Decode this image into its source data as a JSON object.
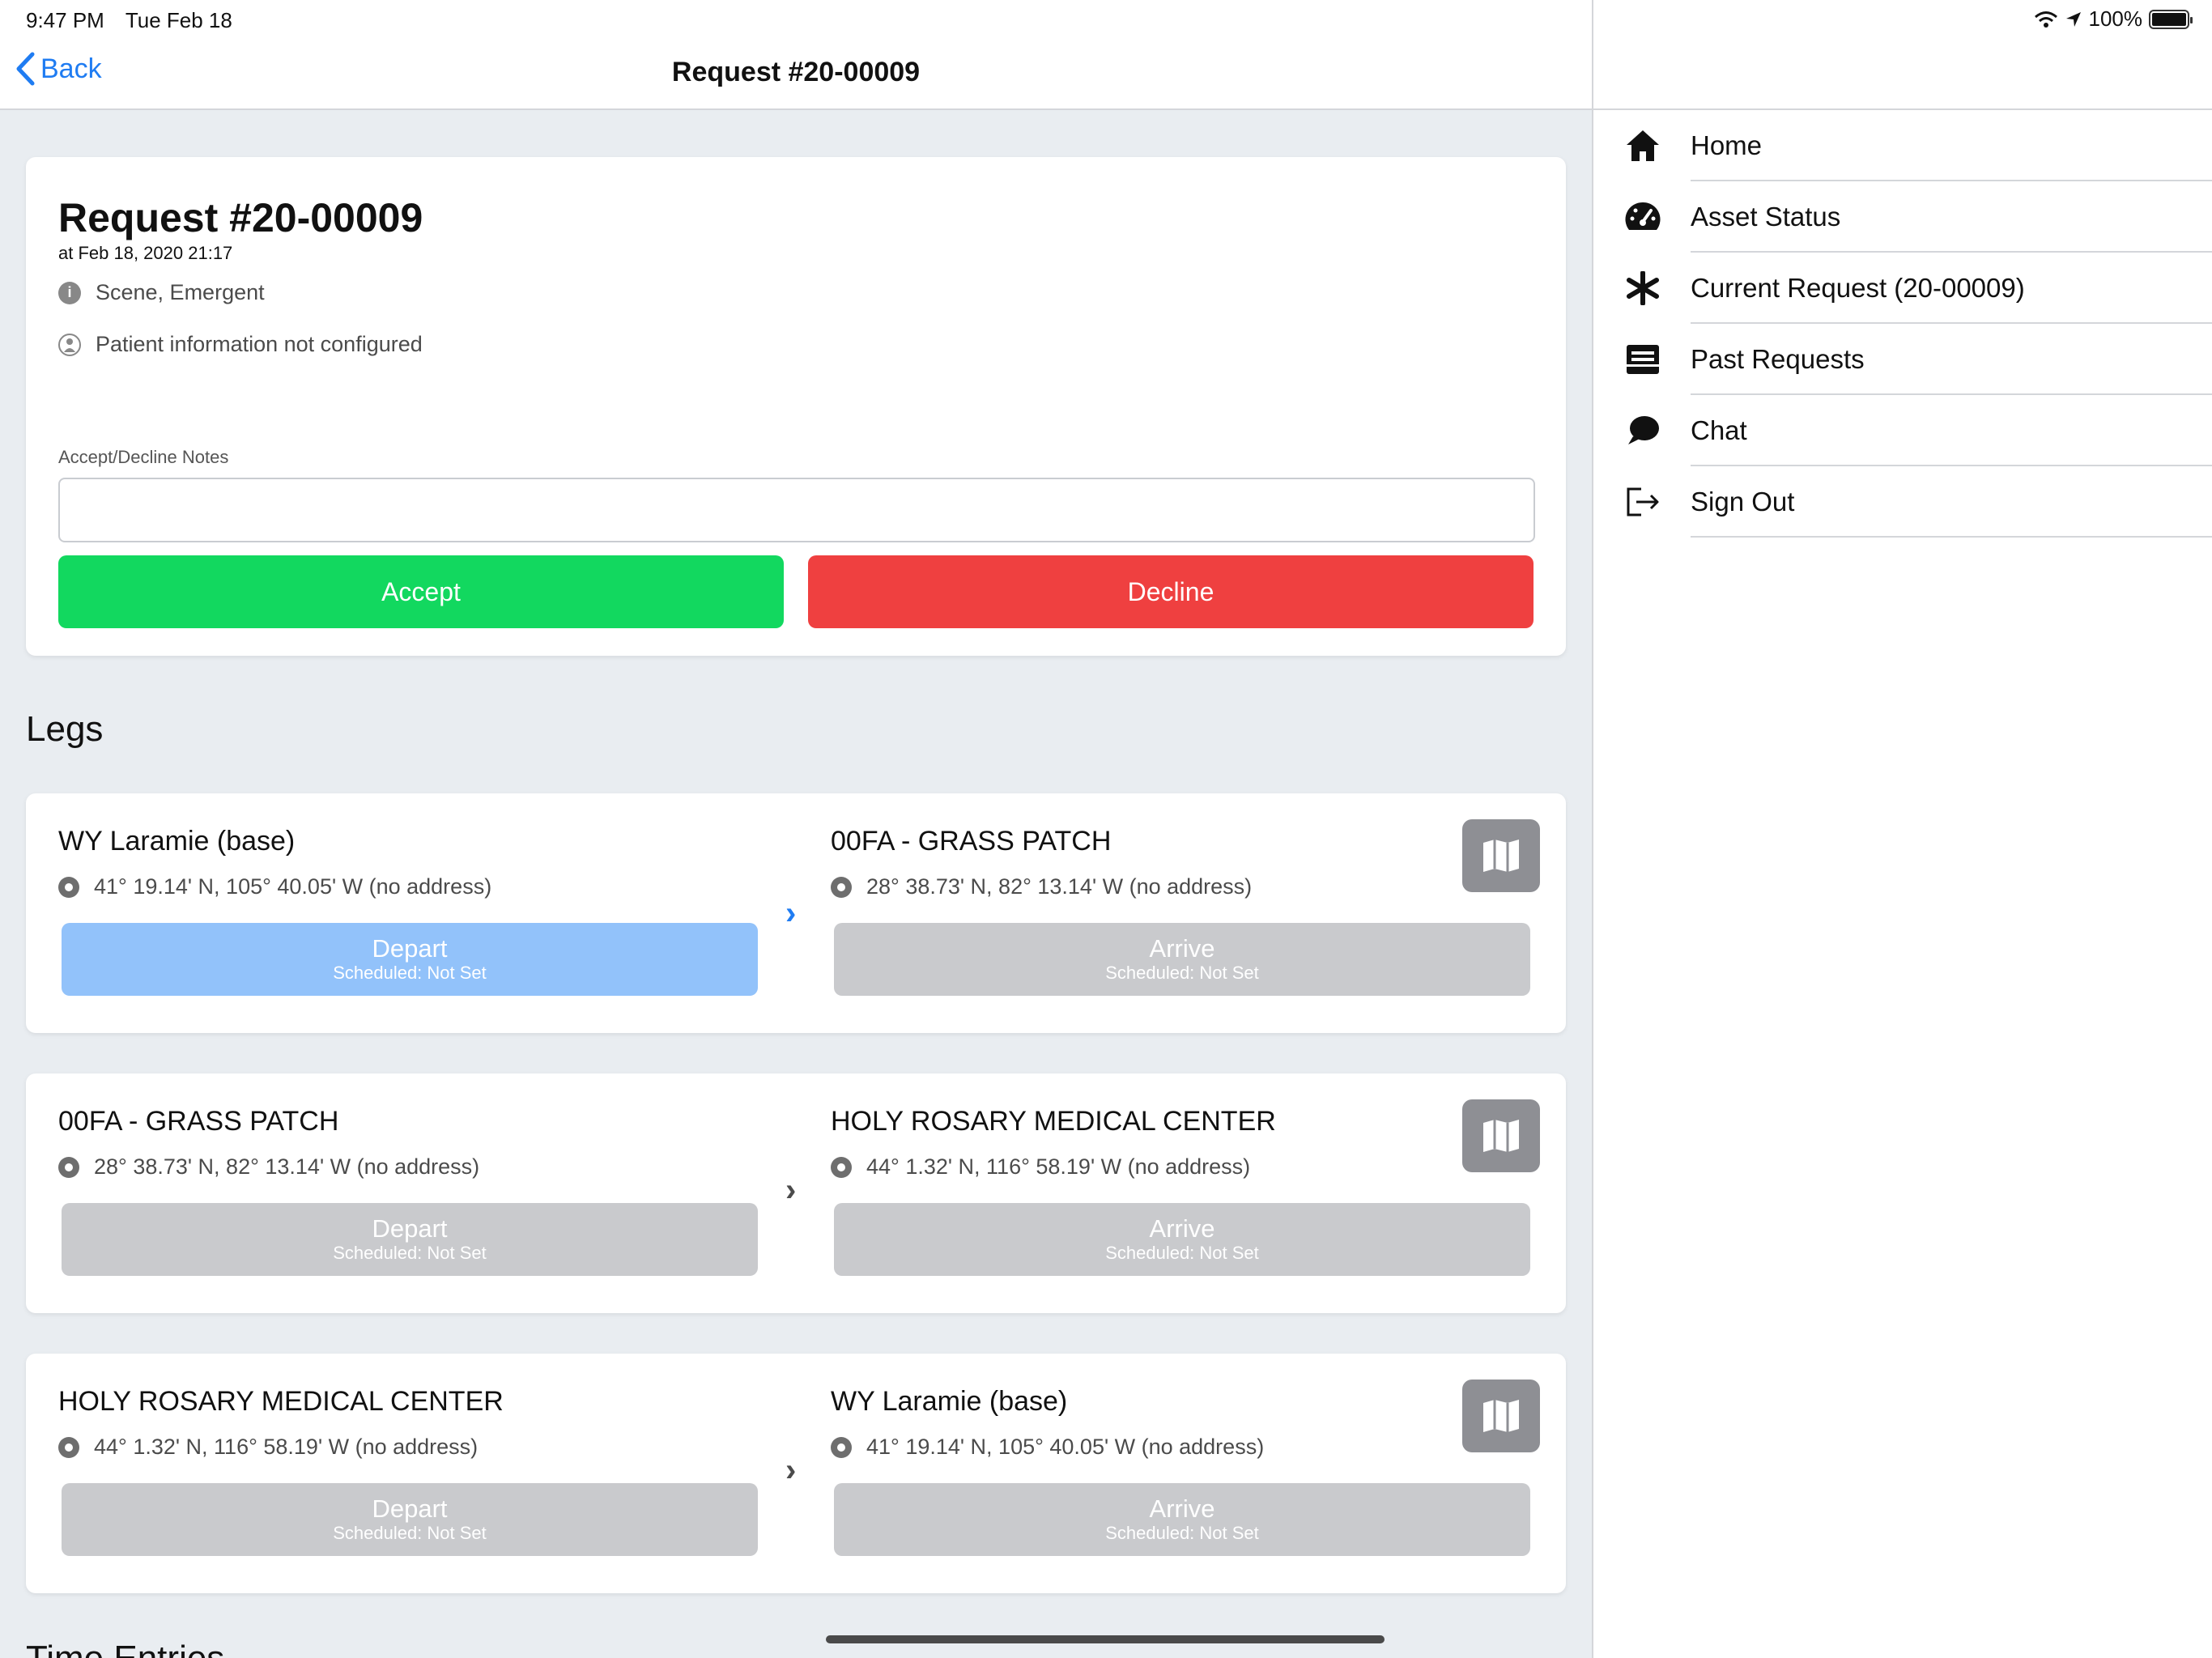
{
  "status_bar": {
    "time": "9:47 PM",
    "date": "Tue Feb 18",
    "battery": "100%"
  },
  "navbar": {
    "back_label": "Back",
    "title": "Request #20-00009"
  },
  "request": {
    "title": "Request #20-00009",
    "timestamp": "at Feb 18, 2020 21:17",
    "type": "Scene, Emergent",
    "patient": "Patient information not configured",
    "notes_label": "Accept/Decline Notes",
    "notes_value": "",
    "accept_label": "Accept",
    "decline_label": "Decline"
  },
  "legs_title": "Legs",
  "legs": [
    {
      "from": "WY Laramie (base)",
      "from_coord": "41° 19.14' N, 105° 40.05' W (no address)",
      "to": "00FA - GRASS PATCH",
      "to_coord": "28° 38.73' N, 82° 13.14' W (no address)",
      "depart_label": "Depart",
      "depart_sub": "Scheduled: Not Set",
      "arrive_label": "Arrive",
      "arrive_sub": "Scheduled: Not Set"
    },
    {
      "from": "00FA - GRASS PATCH",
      "from_coord": "28° 38.73' N, 82° 13.14' W (no address)",
      "to": "HOLY ROSARY MEDICAL CENTER",
      "to_coord": "44° 1.32' N, 116° 58.19' W (no address)",
      "depart_label": "Depart",
      "depart_sub": "Scheduled: Not Set",
      "arrive_label": "Arrive",
      "arrive_sub": "Scheduled: Not Set"
    },
    {
      "from": "HOLY ROSARY MEDICAL CENTER",
      "from_coord": "44° 1.32' N, 116° 58.19' W (no address)",
      "to": "WY Laramie (base)",
      "to_coord": "41° 19.14' N, 105° 40.05' W (no address)",
      "depart_label": "Depart",
      "depart_sub": "Scheduled: Not Set",
      "arrive_label": "Arrive",
      "arrive_sub": "Scheduled: Not Set"
    }
  ],
  "next_section_partial": "Time Entries",
  "menu": [
    {
      "label": "Home",
      "icon": "home-icon"
    },
    {
      "label": "Asset Status",
      "icon": "speedometer-icon"
    },
    {
      "label": "Current Request (20-00009)",
      "icon": "asterisk-icon"
    },
    {
      "label": "Past Requests",
      "icon": "archive-icon"
    },
    {
      "label": "Chat",
      "icon": "chat-bubble-icon"
    },
    {
      "label": "Sign Out",
      "icon": "sign-out-icon"
    }
  ],
  "colors": {
    "accent": "#1f7cf2",
    "accept": "#12d85f",
    "decline": "#ef4040",
    "depart_active": "#92c2fa",
    "disabled": "#c9cacd"
  }
}
